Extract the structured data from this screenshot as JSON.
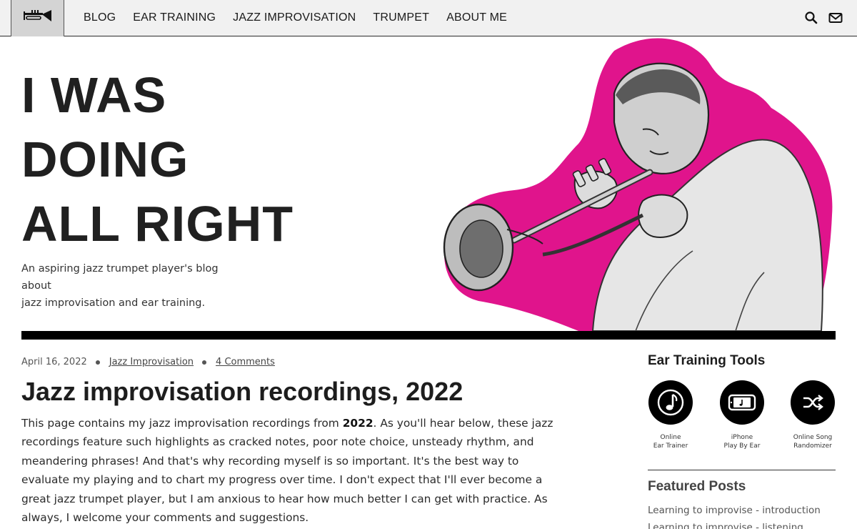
{
  "nav": {
    "items": [
      {
        "label": "BLOG"
      },
      {
        "label": "EAR TRAINING"
      },
      {
        "label": "JAZZ IMPROVISATION"
      },
      {
        "label": "TRUMPET"
      },
      {
        "label": "ABOUT ME"
      }
    ],
    "icons": [
      "trumpet-logo-icon",
      "search-icon",
      "mail-icon"
    ]
  },
  "hero": {
    "title_lines": [
      "I WAS",
      "DOING",
      "ALL RIGHT"
    ],
    "tagline_line1": "An aspiring jazz trumpet player's blog about",
    "tagline_line2": "jazz improvisation and ear training.",
    "accent_color": "#e0148c"
  },
  "post": {
    "date": "April 16, 2022",
    "category": "Jazz Improvisation",
    "comments": "4 Comments",
    "title": "Jazz improvisation recordings, 2022",
    "body_before": "This page contains my jazz improvisation recordings from ",
    "body_bold": "2022",
    "body_after": ". As you'll hear below, these jazz recordings feature such highlights as cracked notes, poor note choice, unsteady rhythm, and meandering phrases! And that's why recording myself is so important. It's the best way to evaluate my playing and to chart my progress over time. I don't expect that I'll ever become a great jazz trumpet player, but I am anxious to hear how much better I can get with practice. As always, I welcome your comments and suggestions."
  },
  "sidebar": {
    "tools_heading": "Ear Training Tools",
    "tools": [
      {
        "line1": "Online",
        "line2": "Ear Trainer",
        "icon": "music-note-icon"
      },
      {
        "line1": "iPhone",
        "line2": "Play By Ear",
        "icon": "phone-icon"
      },
      {
        "line1": "Online Song",
        "line2": "Randomizer",
        "icon": "shuffle-icon"
      }
    ],
    "featured_heading": "Featured Posts",
    "featured": [
      "Learning to improvise - introduction",
      "Learning to improvise - listening"
    ]
  }
}
